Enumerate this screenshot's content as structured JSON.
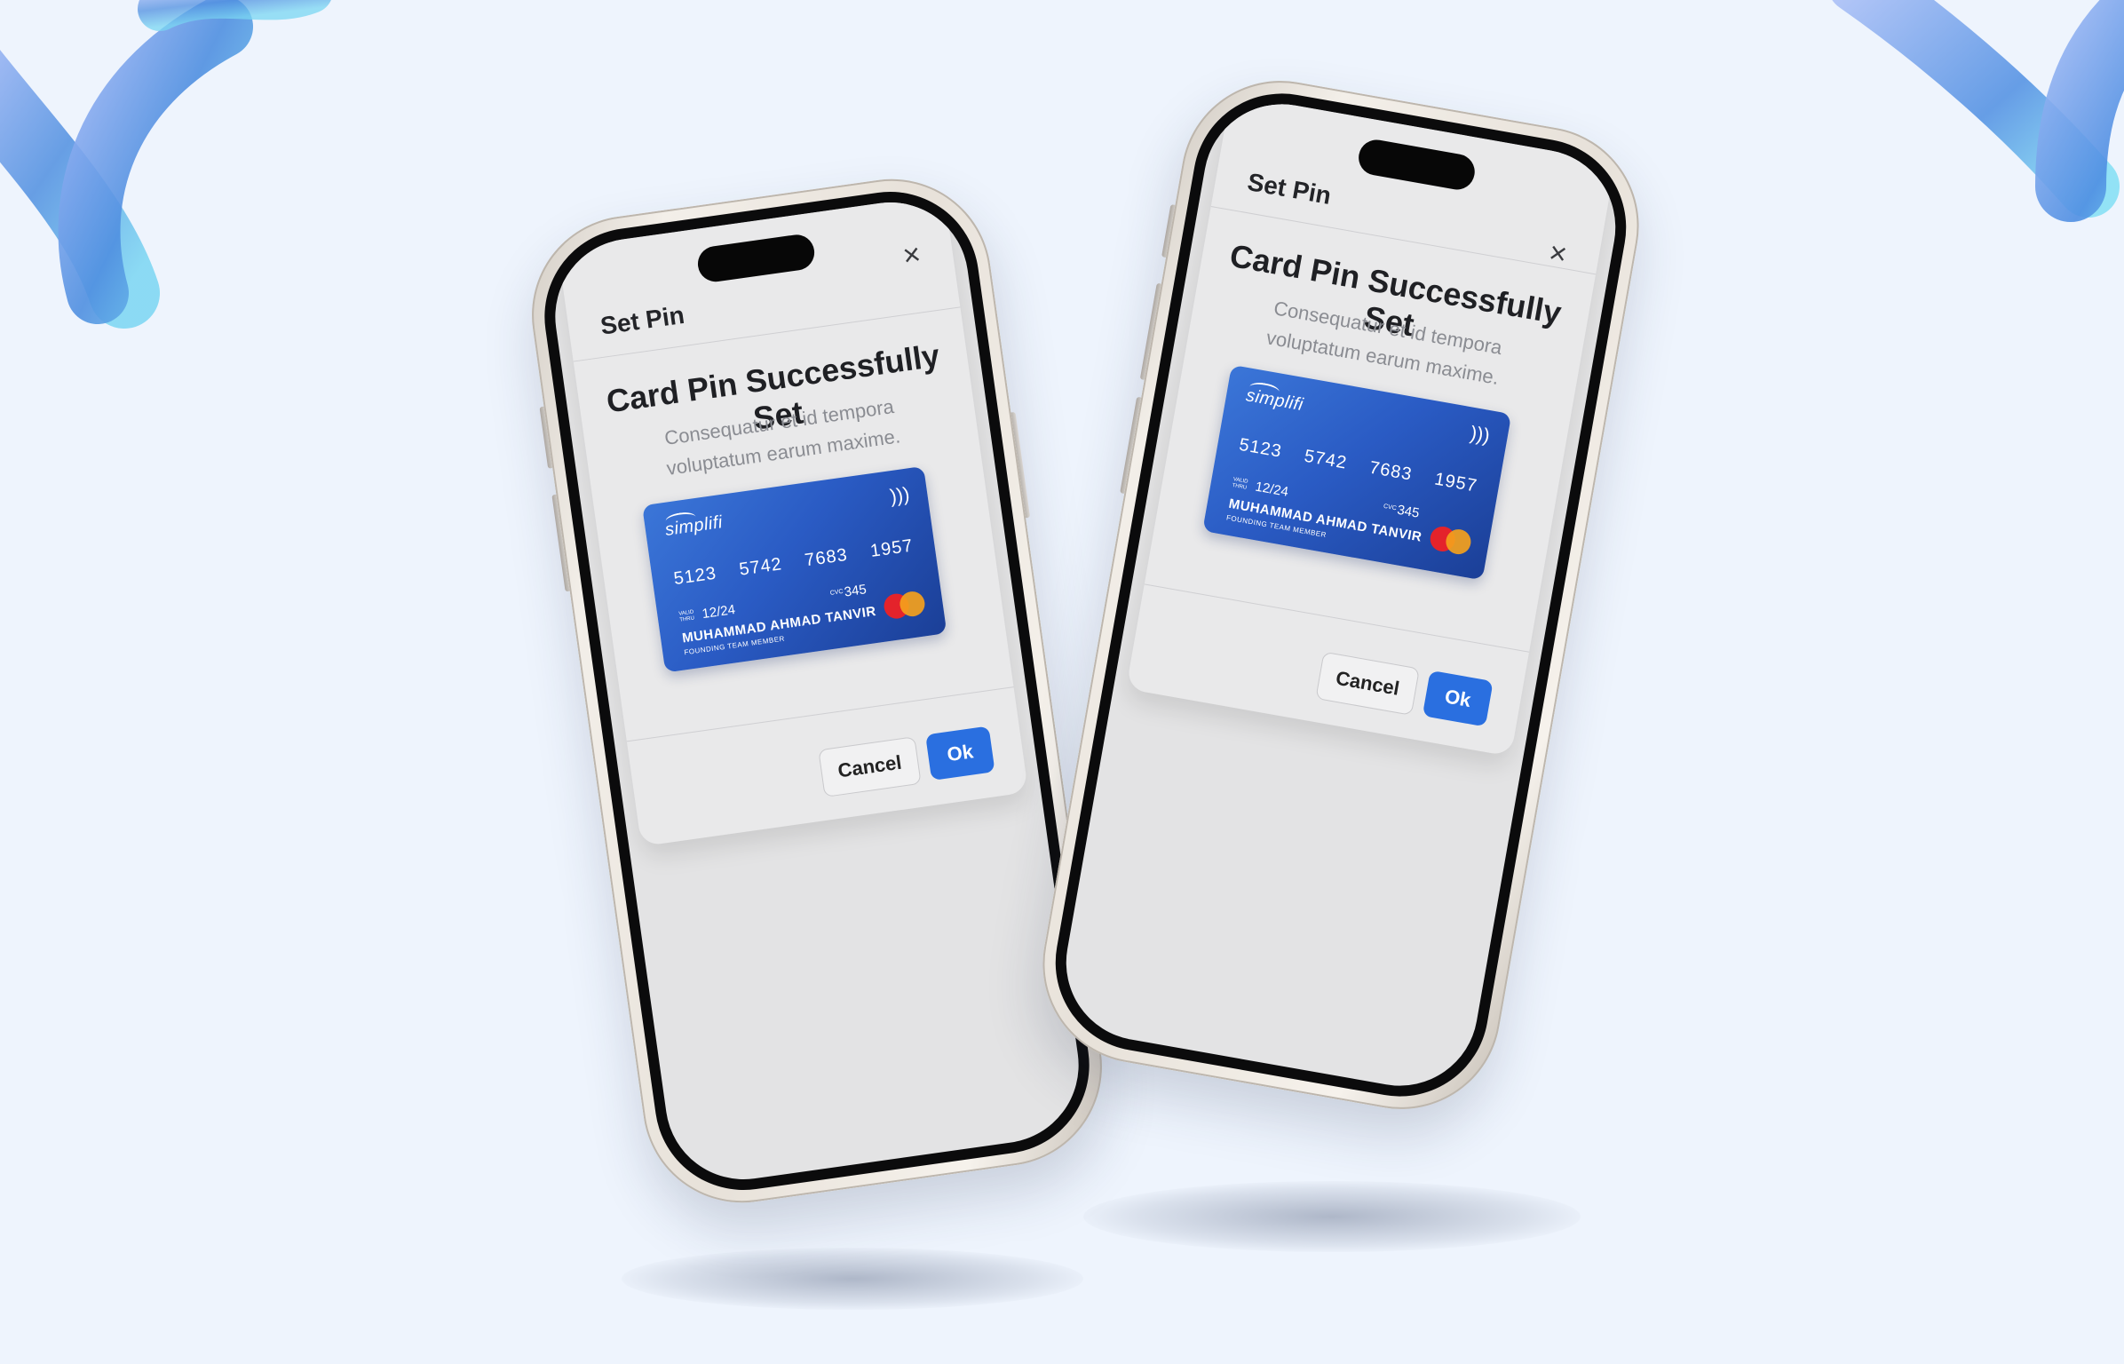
{
  "modal": {
    "title": "Set Pin",
    "close_icon": "close-icon",
    "heading": "Card Pin Successfully Set",
    "description": "Consequatur et id tempora voluptatum earum maxime.",
    "cancel_label": "Cancel",
    "ok_label": "Ok"
  },
  "card": {
    "brand": "simplifi",
    "number_groups": [
      "5123",
      "5742",
      "7683",
      "1957"
    ],
    "valid_label": "VALID THRU",
    "expiry": "12/24",
    "cvc_label": "CVC",
    "cvc": "345",
    "holder_name": "MUHAMMAD AHMAD TANVIR",
    "holder_title": "FOUNDING TEAM MEMBER",
    "network_icon": "mastercard-logo",
    "contactless_icon": "contactless-icon"
  },
  "colors": {
    "background": "#eef4fd",
    "card_blue": "#2a5bc4",
    "ok_button": "#2a6fe0"
  }
}
